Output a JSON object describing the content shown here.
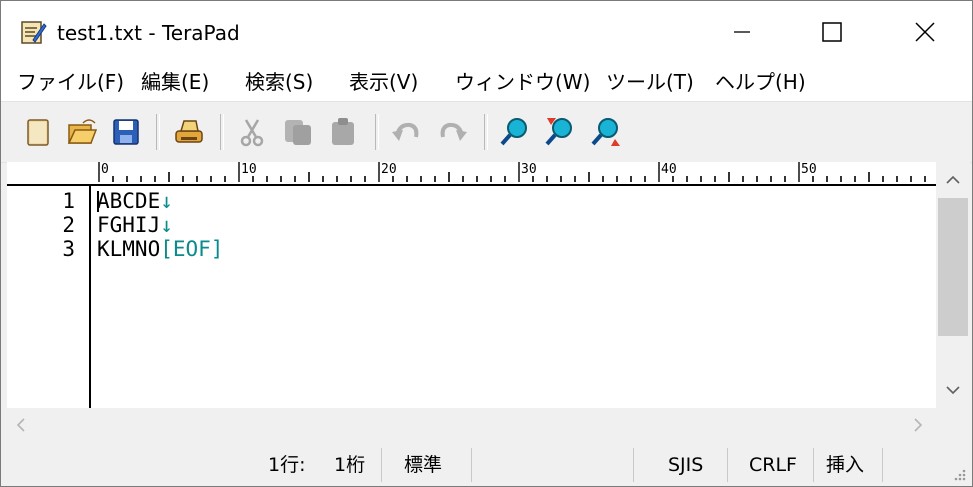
{
  "window": {
    "title": "test1.txt - TeraPad"
  },
  "menu": [
    "ファイル(F)",
    "編集(E)",
    "検索(S)",
    "表示(V)",
    "ウィンドウ(W)",
    "ツール(T)",
    "ヘルプ(H)"
  ],
  "toolbar": {
    "icons": [
      "new-file-icon",
      "open-folder-icon",
      "save-icon",
      "print-icon",
      "cut-icon",
      "copy-icon",
      "paste-icon",
      "undo-icon",
      "redo-icon",
      "search-icon",
      "search-prev-icon",
      "search-next-icon"
    ]
  },
  "ruler": {
    "labels": [
      "0",
      "10",
      "20",
      "30",
      "40",
      "50"
    ]
  },
  "editor": {
    "lines": [
      {
        "num": "1",
        "text": "ABCDE",
        "end": "↓"
      },
      {
        "num": "2",
        "text": "FGHIJ",
        "end": "↓"
      },
      {
        "num": "3",
        "text": "KLMNO",
        "end": "[EOF]"
      }
    ]
  },
  "status": {
    "line": "1行:",
    "col": "1桁",
    "mode": "標準",
    "encoding": "SJIS",
    "newline": "CRLF",
    "insert": "挿入"
  },
  "colors": {
    "accent": "#0a8a8a",
    "search": "#19b3d6"
  }
}
